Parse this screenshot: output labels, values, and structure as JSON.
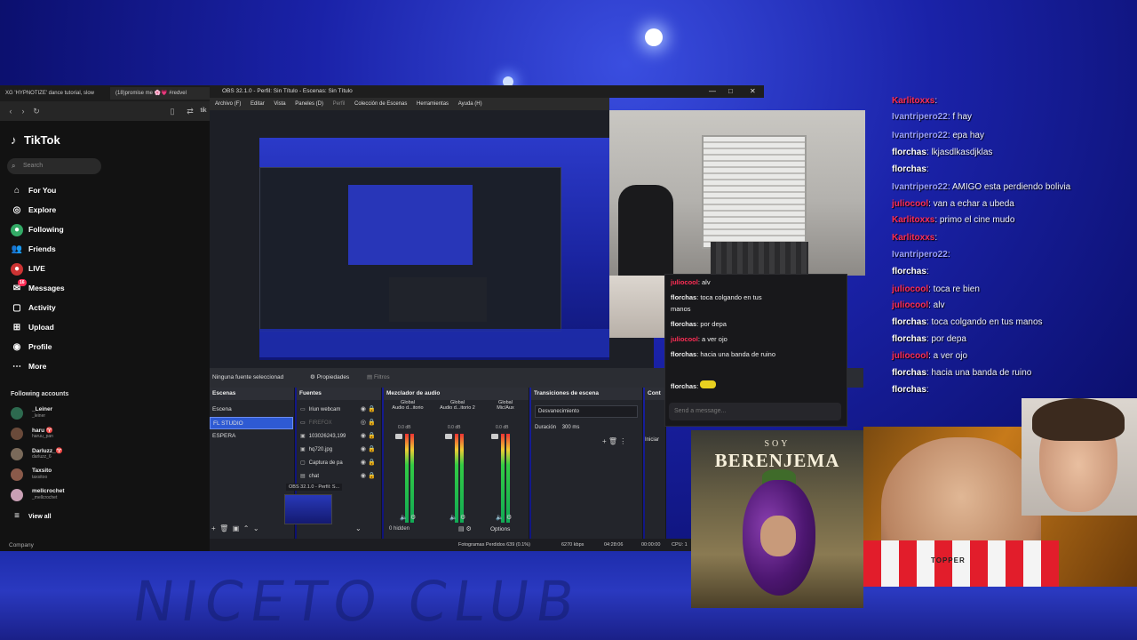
{
  "browser": {
    "tabs": [
      "XG 'HYPNOTIZE' dance tutorial, slow",
      "(18)promise me 🌸💗 #redvel"
    ],
    "address_partial": "tik"
  },
  "tiktok": {
    "logo": "TikTok",
    "search_placeholder": "Search",
    "nav": [
      {
        "icon": "home-icon",
        "label": "For You"
      },
      {
        "icon": "compass-icon",
        "label": "Explore"
      },
      {
        "icon": "following-icon",
        "label": "Following"
      },
      {
        "icon": "friends-icon",
        "label": "Friends"
      },
      {
        "icon": "live-icon",
        "label": "LIVE"
      },
      {
        "icon": "messages-icon",
        "label": "Messages",
        "badge": "16"
      },
      {
        "icon": "activity-icon",
        "label": "Activity"
      },
      {
        "icon": "upload-icon",
        "label": "Upload"
      },
      {
        "icon": "profile-icon",
        "label": "Profile"
      },
      {
        "icon": "more-icon",
        "label": "More"
      }
    ],
    "following_title": "Following accounts",
    "accounts": [
      {
        "name": "_Leiner",
        "handle": "_leiner"
      },
      {
        "name": "haru ♈",
        "handle": "haruu_pan"
      },
      {
        "name": "Darluzz_♈",
        "handle": "darluzz_6"
      },
      {
        "name": "Taxsito",
        "handle": "taxsitoo"
      },
      {
        "name": "mellcrochet",
        "handle": "_mellcrochet"
      }
    ],
    "view_all": "View all",
    "company": "Company"
  },
  "obs": {
    "title": "OBS 32.1.0 - Perfil: Sin Título - Escenas: Sin Título",
    "menu": [
      "Archivo (F)",
      "Editar",
      "Vista",
      "Paneles (D)",
      "Perfil",
      "Colección de Escenas",
      "Herramientas",
      "Ayuda (H)"
    ],
    "no_source": "Ninguna fuente seleccionad",
    "properties": "Propiedades",
    "filters": "Filtros",
    "scenes_title": "Escenas",
    "scenes": [
      "Escena",
      "FL STUDIO",
      "ESPERA"
    ],
    "selected_scene": "FL STUDIO",
    "sources_title": "Fuentes",
    "sources": [
      {
        "icon": "webcam-icon",
        "name": "Iriun webcam",
        "dim": false
      },
      {
        "icon": "browser-icon",
        "name": "FIREFOX",
        "dim": true
      },
      {
        "icon": "image-icon",
        "name": "103026243,199",
        "dim": false
      },
      {
        "icon": "image-icon",
        "name": "hq720.jpg",
        "dim": false
      },
      {
        "icon": "capture-icon",
        "name": "Captura de pa",
        "dim": false
      },
      {
        "icon": "chat-icon",
        "name": "chat",
        "dim": false
      }
    ],
    "drag_label": "OBS 32.1.0 - Perfil: S...",
    "mixer_title": "Mezclador de audio",
    "channels": [
      {
        "label": "Audio d...itorio",
        "global": "Global",
        "db": "0.0 dB"
      },
      {
        "label": "Audio d...itorio 2",
        "global": "Global",
        "db": "0.0 dB"
      },
      {
        "label": "Mic/Aux",
        "global": "Global",
        "db": "0.0 dB"
      }
    ],
    "hidden": "0 hidden",
    "transitions_title": "Transiciones de escena",
    "transition": "Desvanecimiento",
    "duration_label": "Duración",
    "duration_value": "300 ms",
    "options": "Options",
    "controls_title": "Cont",
    "start_label": "Iniciar",
    "status": {
      "dropped": "Fotogramas Perdidos 639 (0.1%)",
      "bitrate": "6270 kbps",
      "time_live": "04:28:06",
      "time_rec": "00:00:00",
      "cpu": "CPU: 1"
    }
  },
  "chat_mid": {
    "lines": [
      {
        "user": "juliocool",
        "text": ": alv",
        "color": "#ff2d55"
      },
      {
        "user": "florchas",
        "text": ": toca colgando en tus",
        "color": "#ffffff"
      },
      {
        "user": "",
        "text": "manos",
        "color": "#ffffff"
      },
      {
        "user": "florchas",
        "text": ": por depa",
        "color": "#ffffff"
      },
      {
        "user": "juliocool",
        "text": ": a ver ojo",
        "color": "#ff2d55"
      },
      {
        "user": "florchas",
        "text": ": hacia una banda de ruino",
        "color": "#ffffff"
      },
      {
        "user": "florchas",
        "text": ":",
        "color": "#ffffff"
      }
    ],
    "input_placeholder": "Send a message..."
  },
  "chat_right": [
    {
      "user": "Karlitoxxs",
      "text": ":",
      "color": "#ff2d55"
    },
    {
      "user": "Ivantripero22",
      "text": ": f    hay",
      "color": "#9aa0ff"
    },
    {
      "user": "Ivantripero22",
      "text": ": epa    hay",
      "color": "#9aa0ff"
    },
    {
      "user": "florchas",
      "text": ": lkjasdlkasdjklas",
      "color": "#ffffff"
    },
    {
      "user": "florchas",
      "text": ":",
      "color": "#ffffff"
    },
    {
      "user": "Ivantripero22",
      "text": ": AMIGO esta perdiendo bolivia",
      "color": "#9aa0ff"
    },
    {
      "user": "juliocool",
      "text": ": van a echar a ubeda",
      "color": "#ff2d55"
    },
    {
      "user": "Karlitoxxs",
      "text": ": primo el cine mudo",
      "color": "#ff2d55"
    },
    {
      "user": "Karlitoxxs",
      "text": ":",
      "color": "#ff2d55"
    },
    {
      "user": "Ivantripero22",
      "text": ":",
      "color": "#9aa0ff"
    },
    {
      "user": "florchas",
      "text": ":",
      "color": "#ffffff"
    },
    {
      "user": "juliocool",
      "text": ": toca re bien",
      "color": "#ff2d55"
    },
    {
      "user": "juliocool",
      "text": ": alv",
      "color": "#ff2d55"
    },
    {
      "user": "florchas",
      "text": ": toca colgando en tus manos",
      "color": "#ffffff"
    },
    {
      "user": "florchas",
      "text": ": por depa",
      "color": "#ffffff"
    },
    {
      "user": "juliocool",
      "text": ": a ver ojo",
      "color": "#ff2d55"
    },
    {
      "user": "florchas",
      "text": ": hacia una banda de ruino",
      "color": "#ffffff"
    },
    {
      "user": "florchas",
      "text": ":",
      "color": "#ffffff"
    }
  ],
  "album": {
    "line1": "SOY",
    "line2": "BERENJEMA"
  },
  "jersey_text": "TOPPER",
  "stage_text": "NICETO CLUB"
}
